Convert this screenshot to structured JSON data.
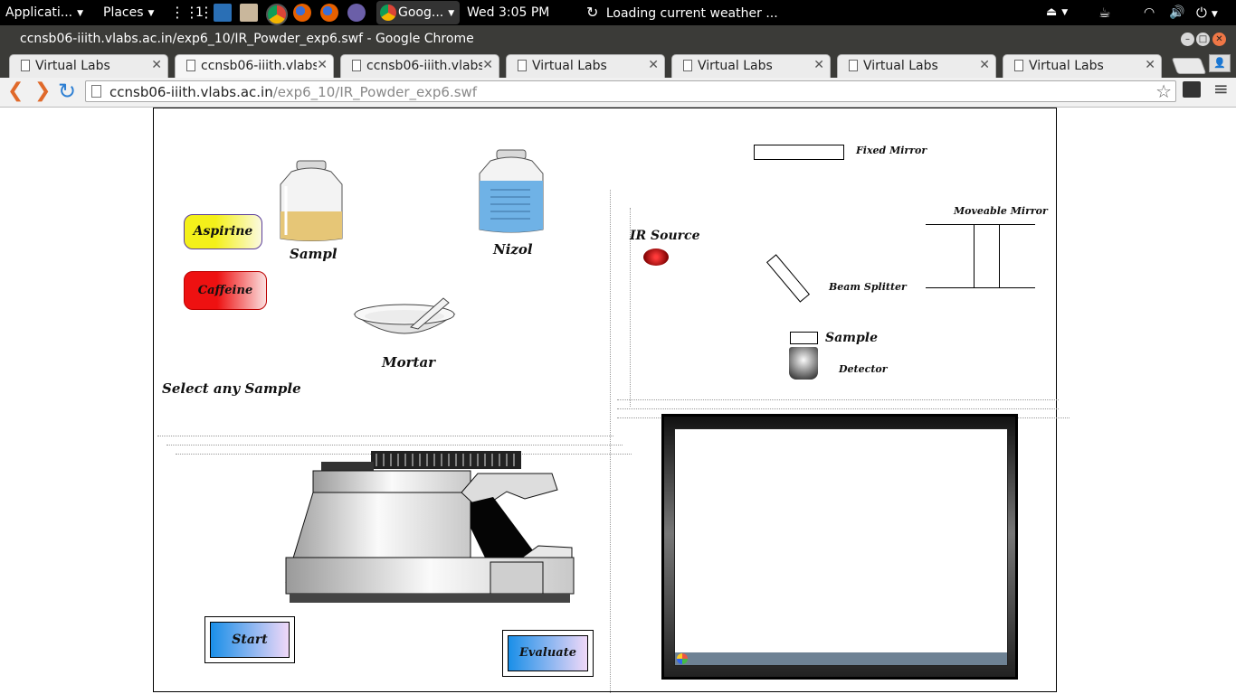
{
  "panel": {
    "applications": "Applicati...",
    "places": "Places",
    "workspace": "1",
    "chrome_task": "Goog...",
    "clock": "Wed  3:05 PM",
    "weather": "Loading current weather ..."
  },
  "window": {
    "title": "ccnsb06-iiith.vlabs.ac.in/exp6_10/IR_Powder_exp6.swf - Google Chrome"
  },
  "tabs": [
    {
      "title": "Virtual Labs"
    },
    {
      "title": "ccnsb06-iiith.vlabs"
    },
    {
      "title": "ccnsb06-iiith.vlabs"
    },
    {
      "title": "Virtual Labs"
    },
    {
      "title": "Virtual Labs"
    },
    {
      "title": "Virtual Labs"
    },
    {
      "title": "Virtual Labs"
    }
  ],
  "active_tab": 1,
  "address_bar": {
    "host": "ccnsb06-iiith.vlabs.ac.in",
    "path": "/exp6_10/IR_Powder_exp6.swf"
  },
  "experiment": {
    "samples": {
      "aspirine": "Aspirine",
      "caffeine": "Caffeine"
    },
    "sample_jar_label": "Sampl",
    "nizol_jar_label": "Nizol",
    "mortar_label": "Mortar",
    "select_hint": "Select any Sample",
    "diagram": {
      "fixed_mirror": "Fixed Mirror",
      "moveable_mirror": "Moveable Mirror",
      "ir_source": "IR Source",
      "beam_splitter": "Beam Splitter",
      "sample": "Sample",
      "detector": "Detector"
    },
    "buttons": {
      "start": "Start",
      "evaluate": "Evaluate"
    }
  },
  "colors": {
    "aspirine_fill": "#f4f01a",
    "caffeine_fill": "#ee1111",
    "water_fill": "#6fb2e6",
    "powder_fill": "#e6c677",
    "button_gradient_start": "#1a8fe8",
    "button_gradient_end": "#f0d8f8"
  }
}
